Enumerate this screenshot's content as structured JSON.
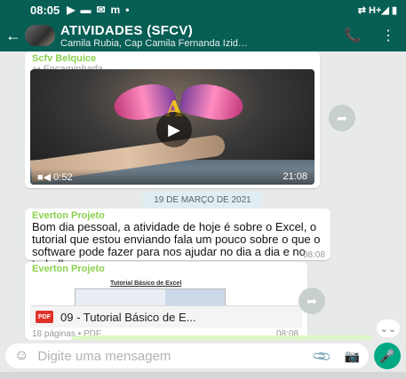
{
  "status_bar": {
    "time": "08:05",
    "notif_icons": [
      "▶",
      "▬",
      "✉",
      "m",
      "•"
    ],
    "right_icons": "⇄ H+◢ ▮"
  },
  "header": {
    "back_icon": "←",
    "title": "ATIVIDADES (SFCV)",
    "subtitle": "Camila Rubia, Cap Camila Fernanda Izid…",
    "call_icon": "📞",
    "menu_icon": "⋮"
  },
  "messages": {
    "video_msg": {
      "sender": "Scfv Belquice",
      "forwarded": "↪ Encaminhada",
      "video_letter": "A",
      "play_icon": "▶",
      "duration": "■◀ 0:52",
      "time": "21:08"
    },
    "date_chip": "19 DE MARÇO DE 2021",
    "text_msg": {
      "sender": "Everton Projeto",
      "text": "Bom dia pessoal, a atividade de hoje é sobre o Excel, o tutorial que estou enviando fala um pouco sobre o que o software pode fazer para nos ajudar no dia a dia e no trabalho",
      "time": "08:08"
    },
    "doc_msg": {
      "sender": "Everton Projeto",
      "preview_title": "Tutorial Básico de Excel",
      "file_badge": "PDF",
      "file_name": "09 - Tutorial Básico de E...",
      "pages": "18 páginas • PDF",
      "time": "08:08"
    },
    "share_icon": "➦",
    "scroll_down_icon": "⌄⌄"
  },
  "input_bar": {
    "emoji_icon": "☺",
    "placeholder": "Digite uma mensagem",
    "attach_icon": "📎",
    "camera_icon": "📷",
    "mic_icon": "🎤"
  },
  "colors": {
    "header_bg": "#075e54",
    "accent": "#00a884",
    "sender_name": "#8bd14f"
  }
}
